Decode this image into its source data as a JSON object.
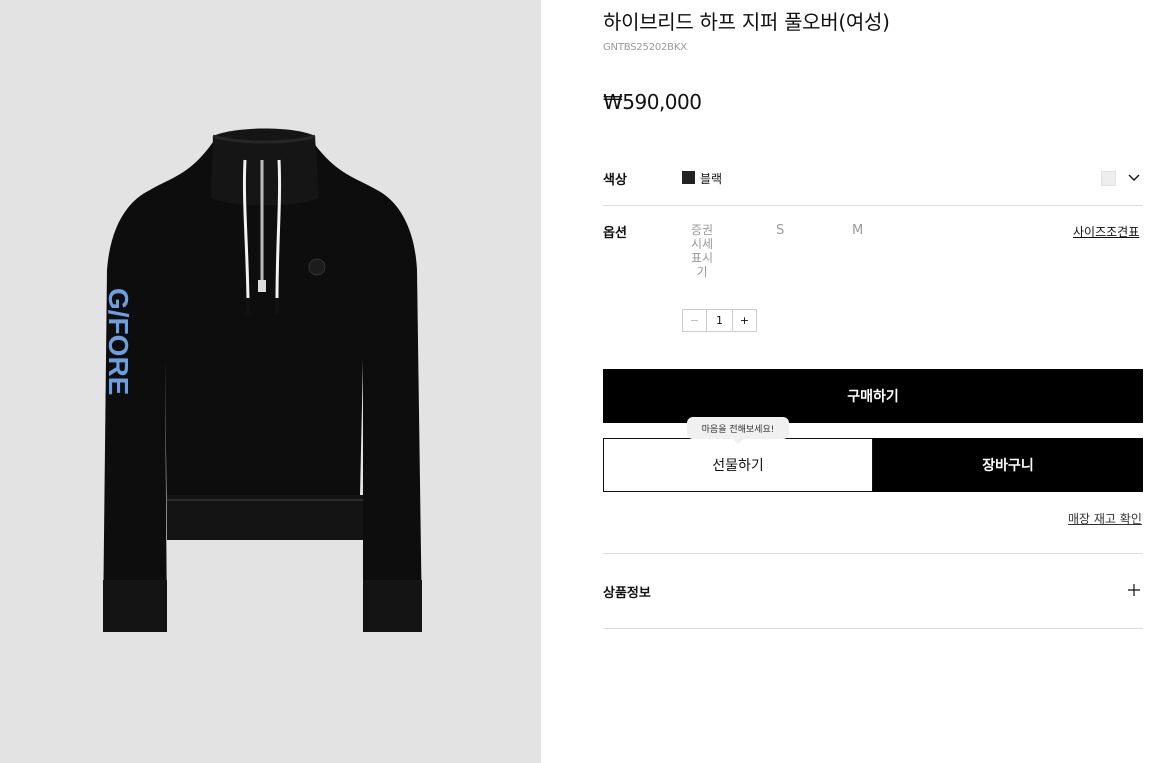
{
  "product": {
    "title": "하이브리드 하프 지퍼 풀오버(여성)",
    "code": "GNTBS25202BKX",
    "price": "₩590,000",
    "image_sleeve_text": "G/FORE"
  },
  "options": {
    "color_label": "색상",
    "color_value": "블랙",
    "color_hex": "#222222",
    "option_label": "옵션",
    "sizes": [
      "증권시세표시기",
      "S",
      "M"
    ],
    "size_guide": "사이즈조견표"
  },
  "quantity": {
    "value": "1",
    "minus": "−",
    "plus": "+"
  },
  "actions": {
    "buy": "구매하기",
    "gift": "선물하기",
    "gift_tooltip": "마음을 전해보세요!",
    "cart": "장바구니",
    "store_stock": "매장 재고 확인"
  },
  "info": {
    "title": "상품정보"
  },
  "colors": {
    "left_bg": "#e3e3e3",
    "primary": "#000000",
    "divider": "#dcdcdc",
    "sleeve_print": "#6d9fe0"
  }
}
